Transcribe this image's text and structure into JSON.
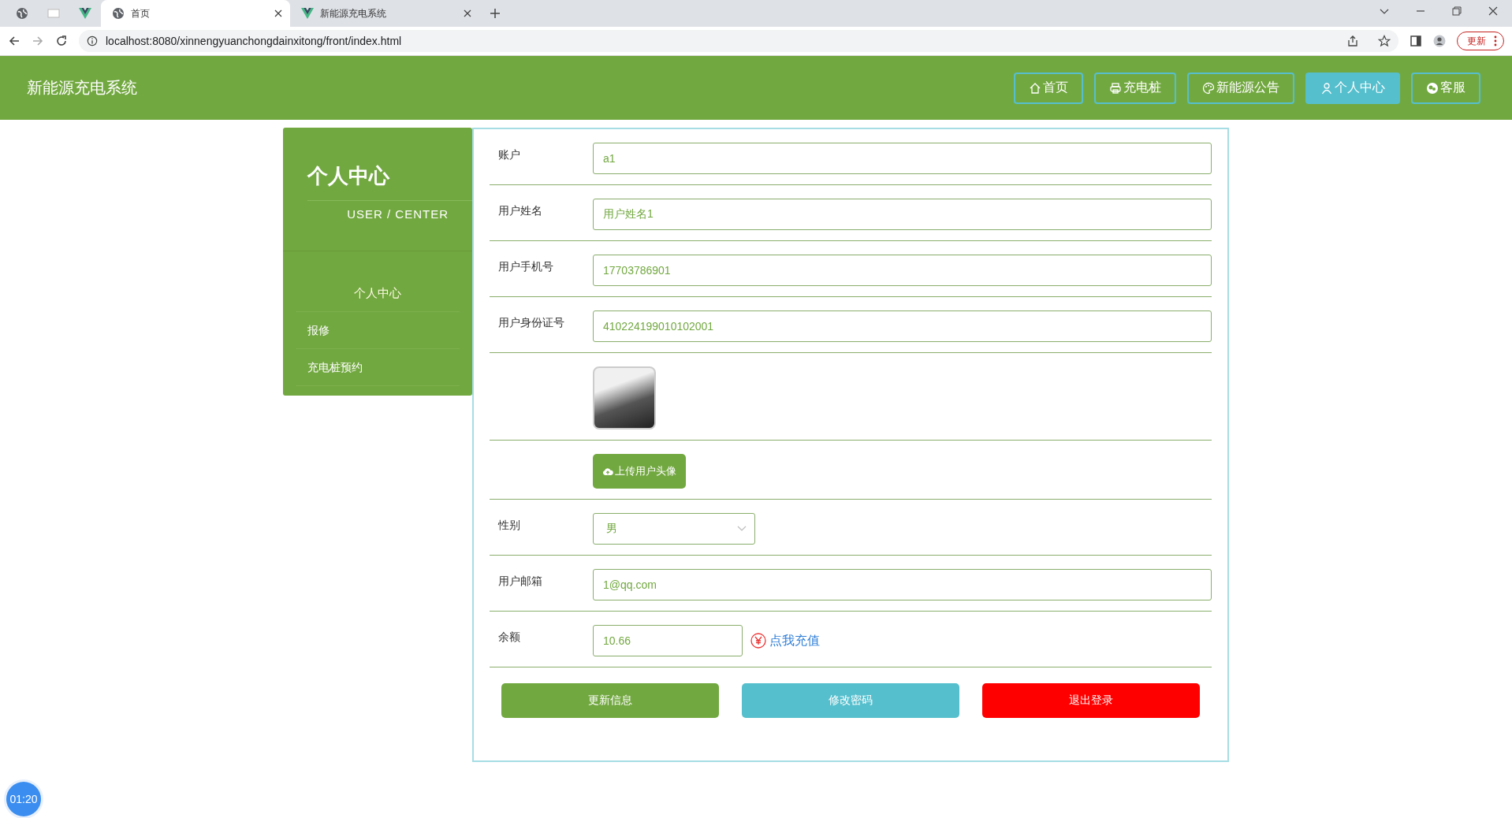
{
  "browser": {
    "tabs": [
      {
        "kind": "globe",
        "selected": false
      },
      {
        "kind": "blank",
        "selected": false
      },
      {
        "kind": "vue",
        "selected": false
      },
      {
        "kind": "globe",
        "title": "首页",
        "selected": true
      },
      {
        "kind": "vue",
        "title": "新能源充电系统",
        "selected": false
      }
    ],
    "url": "localhost:8080/xinnengyuanchongdainxitong/front/index.html",
    "update_button": "更新"
  },
  "header": {
    "title": "新能源充电系统",
    "nav": [
      {
        "kind": "home",
        "label": "首页",
        "selected": false
      },
      {
        "kind": "printer",
        "label": "充电桩",
        "selected": false
      },
      {
        "kind": "palette",
        "label": "新能源公告",
        "selected": false
      },
      {
        "kind": "user",
        "label": "个人中心",
        "selected": true
      },
      {
        "kind": "chat",
        "label": "客服",
        "selected": false
      }
    ]
  },
  "sidebar": {
    "title": "个人中心",
    "subtitle": "USER / CENTER",
    "items": [
      {
        "label": "个人中心",
        "selected": true
      },
      {
        "label": "报修",
        "selected": false
      },
      {
        "label": "充电桩预约",
        "selected": false
      }
    ]
  },
  "form": {
    "rows": [
      {
        "kind": "input",
        "label": "账户",
        "value": "a1"
      },
      {
        "kind": "input",
        "label": "用户姓名",
        "value": "用户姓名1"
      },
      {
        "kind": "input",
        "label": "用户手机号",
        "value": "17703786901"
      },
      {
        "kind": "input",
        "label": "用户身份证号",
        "value": "410224199010102001"
      },
      {
        "kind": "avatar"
      },
      {
        "kind": "upload",
        "button": "上传用户头像"
      },
      {
        "kind": "select",
        "label": "性别",
        "value": "男"
      },
      {
        "kind": "input",
        "label": "用户邮箱",
        "value": "1@qq.com"
      },
      {
        "kind": "balance",
        "label": "余额",
        "value": "10.66",
        "link": "点我充值"
      }
    ],
    "actions": [
      {
        "label": "更新信息",
        "color": "#72a840"
      },
      {
        "label": "修改密码",
        "color": "#56bfcd"
      },
      {
        "label": "退出登录",
        "color": "#ff0000"
      }
    ]
  },
  "timer": "01:20"
}
